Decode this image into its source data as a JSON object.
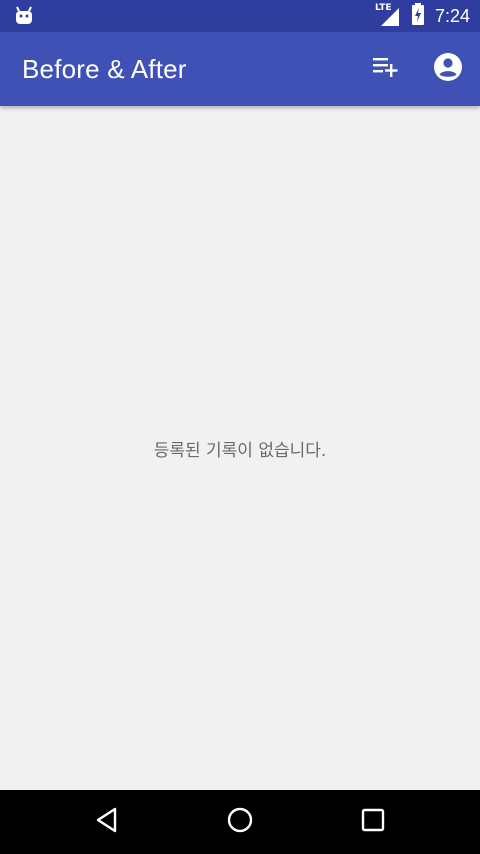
{
  "status_bar": {
    "network_label": "LTE",
    "time": "7:24",
    "icons": [
      "android-notification-icon",
      "signal-icon",
      "battery-charging-icon"
    ]
  },
  "app_bar": {
    "title": "Before & After",
    "actions": [
      {
        "icon": "playlist-add-icon"
      },
      {
        "icon": "account-circle-icon"
      }
    ],
    "background_color": "#3f51b5"
  },
  "main": {
    "empty_message": "등록된 기록이 없습니다.",
    "background_color": "#f1f1f1"
  },
  "nav_bar": {
    "buttons": [
      "back-icon",
      "home-icon",
      "recents-icon"
    ]
  }
}
